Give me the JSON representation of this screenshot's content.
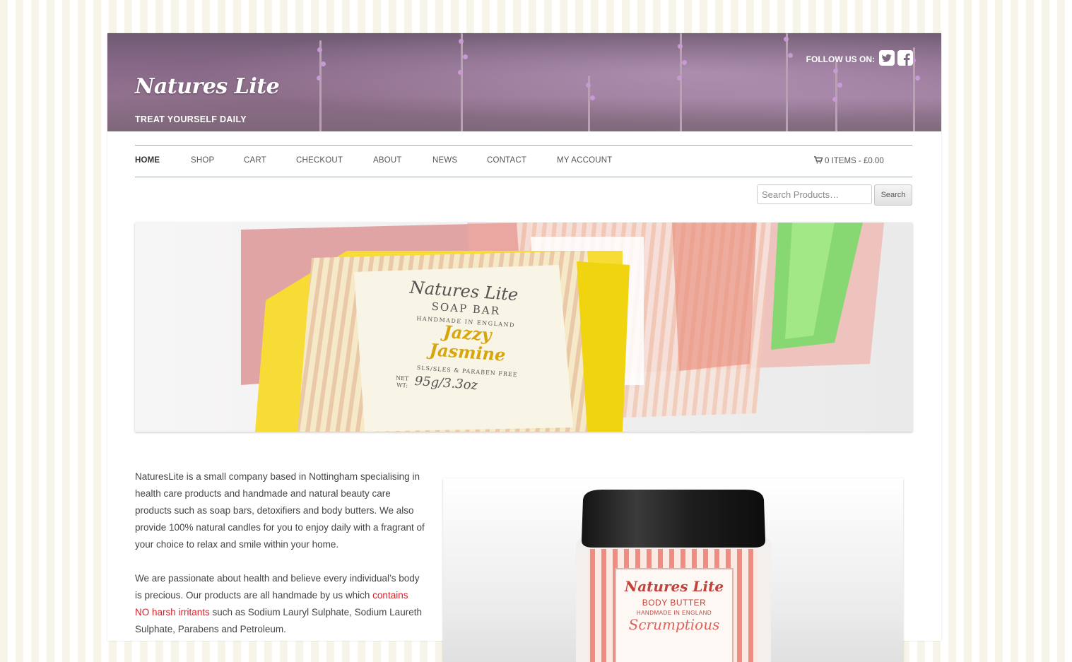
{
  "header": {
    "site_title": "Natures Lite",
    "tagline": "TREAT YOURSELF DAILY",
    "follow_label": "FOLLOW US ON:",
    "social": [
      "twitter-icon",
      "facebook-icon"
    ]
  },
  "nav": {
    "items": [
      "HOME",
      "SHOP",
      "CART",
      "CHECKOUT",
      "ABOUT",
      "NEWS",
      "CONTACT",
      "MY ACCOUNT"
    ],
    "active": "HOME",
    "cart_summary": "0 ITEMS - £0.00"
  },
  "search": {
    "placeholder": "Search Products…",
    "button_label": "Search"
  },
  "hero": {
    "label_brand": "Natures Lite",
    "label_product": "SOAP BAR",
    "label_origin": "HANDMADE IN ENGLAND",
    "label_name_1": "Jazzy",
    "label_name_2": "Jasmine",
    "label_free": "SLS/SLES & PARABEN FREE",
    "label_weight": "95g/3.3oz",
    "label_net": "NET",
    "label_wt": "WT:"
  },
  "intro": {
    "p1": "NaturesLite is a small company based in Nottingham specialising in health care products and handmade and natural beauty care products such as soap bars, detoxifiers and body butters. We also provide 100% natural candles for you to enjoy daily with a fragrant of your choice to relax and smile within your home.",
    "p2_start": "We are passionate about health and believe every individual’s body is precious. Our products are all handmade by us which ",
    "p2_link": "contains NO harsh irritants",
    "p2_end": " such as Sodium Lauryl Sulphate, Sodium Laureth Sulphate, Parabens and Petroleum."
  },
  "product_image": {
    "brand": "Natures Lite",
    "type": "BODY BUTTER",
    "origin": "HANDMADE IN ENGLAND",
    "name": "Scrumptious"
  },
  "colors": {
    "link_red": "#d0222a",
    "stripe": "#f7f4e9",
    "lavender": "#9d7d9e"
  }
}
